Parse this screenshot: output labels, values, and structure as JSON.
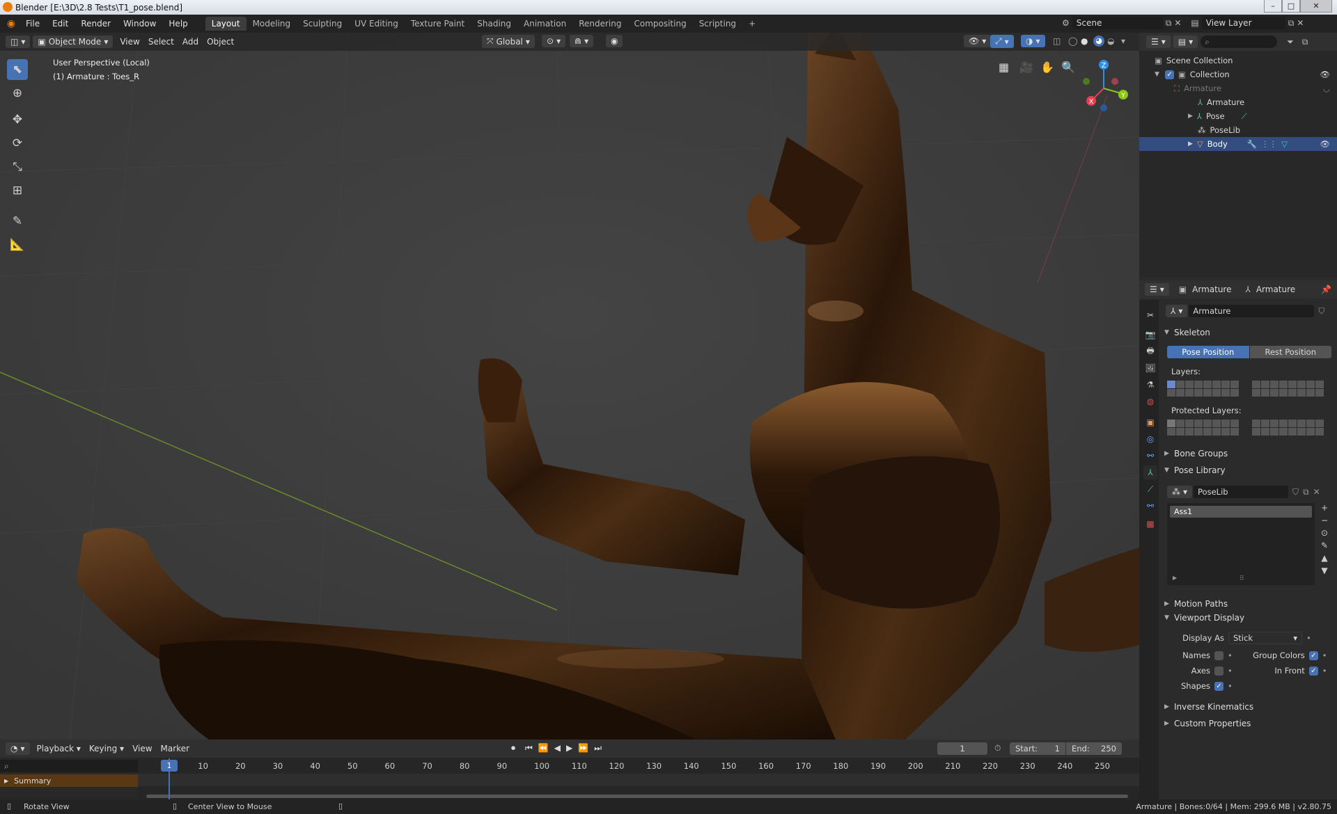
{
  "window_title": "Blender [E:\\3D\\2.8 Tests\\T1_pose.blend]",
  "window_controls": [
    "–",
    "□",
    "✕"
  ],
  "menu": [
    "File",
    "Edit",
    "Render",
    "Window",
    "Help"
  ],
  "workspaces": [
    "Layout",
    "Modeling",
    "Sculpting",
    "UV Editing",
    "Texture Paint",
    "Shading",
    "Animation",
    "Rendering",
    "Compositing",
    "Scripting"
  ],
  "add_workspace": "+",
  "scene_name": "Scene",
  "view_layer": "View Layer",
  "viewport_header": {
    "mode": "Object Mode",
    "menus": [
      "View",
      "Select",
      "Add",
      "Object"
    ],
    "orientation": "Global"
  },
  "viewport": {
    "perspective_label": "User Perspective (Local)",
    "active_label": "(1) Armature : Toes_R",
    "gizmo_axes": {
      "x": "X",
      "y": "Y",
      "z": "Z"
    },
    "colors": {
      "x_axis": "#e83f52",
      "y_axis": "#8bc618",
      "z_axis": "#2e8fe8",
      "grid_line": "#6a8a2a"
    }
  },
  "outliner": {
    "search_placeholder": "",
    "rows": [
      {
        "label": "Scene Collection",
        "icon": "collection-icon"
      },
      {
        "label": "Collection",
        "icon": "collection-icon"
      },
      {
        "label": "Armature",
        "icon": "armature-icon",
        "dim": true
      },
      {
        "label": "Armature",
        "icon": "armature-data-icon"
      },
      {
        "label": "Pose",
        "icon": "pose-icon"
      },
      {
        "label": "PoseLib",
        "icon": "poselib-icon"
      },
      {
        "label": "Body",
        "icon": "mesh-icon",
        "selected": true
      }
    ]
  },
  "properties": {
    "breadcrumb": [
      "Armature",
      "Armature"
    ],
    "datablock_name": "Armature",
    "skeleton": {
      "title": "Skeleton",
      "pose_position": "Pose Position",
      "rest_position": "Rest Position",
      "layers_label": "Layers:",
      "protected_label": "Protected Layers:"
    },
    "bone_groups": "Bone Groups",
    "pose_library": {
      "title": "Pose Library",
      "library_name": "PoseLib",
      "poses": [
        "Ass1"
      ]
    },
    "motion_paths": "Motion Paths",
    "viewport_display": {
      "title": "Viewport Display",
      "display_as_label": "Display As",
      "display_as_value": "Stick",
      "names_label": "Names",
      "names_checked": false,
      "group_colors_label": "Group Colors",
      "group_colors_checked": true,
      "axes_label": "Axes",
      "axes_checked": false,
      "in_front_label": "In Front",
      "in_front_checked": true,
      "shapes_label": "Shapes",
      "shapes_checked": true
    },
    "inverse_kinematics": "Inverse Kinematics",
    "custom_properties": "Custom Properties"
  },
  "timeline": {
    "menus": [
      "Playback",
      "Keying",
      "View",
      "Marker"
    ],
    "current_frame": "1",
    "start_label": "Start:",
    "start_value": "1",
    "end_label": "End:",
    "end_value": "250",
    "ticks": [
      "1",
      "10",
      "20",
      "30",
      "40",
      "50",
      "60",
      "70",
      "80",
      "90",
      "100",
      "110",
      "120",
      "130",
      "140",
      "150",
      "160",
      "170",
      "180",
      "190",
      "200",
      "210",
      "220",
      "230",
      "240",
      "250"
    ],
    "summary_label": "Summary"
  },
  "statusbar": {
    "rotate_view": "Rotate View",
    "center_view": "Center View to Mouse",
    "stats": "Armature | Bones:0/64 | Mem: 299.6 MB | v2.80.75"
  }
}
